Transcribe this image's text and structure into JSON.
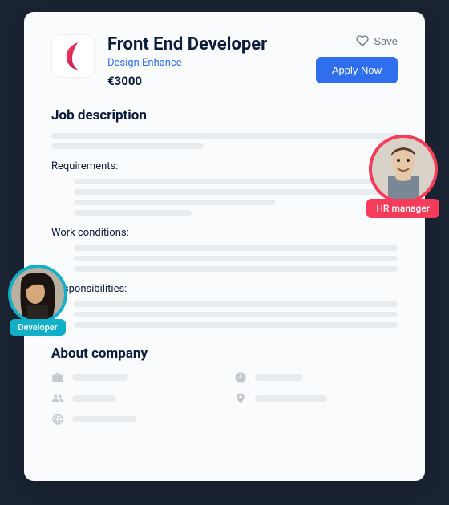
{
  "header": {
    "job_title": "Front End Developer",
    "company": "Design Enhance",
    "salary": "€3000",
    "save_label": "Save",
    "apply_label": "Apply Now"
  },
  "sections": {
    "description_title": "Job description",
    "requirements_label": "Requirements:",
    "work_conditions_label": "Work conditions:",
    "responsibilities_label": "Responsibilities:",
    "about_title": "About company"
  },
  "avatars": {
    "hr_label": "HR manager",
    "dev_label": "Developer"
  },
  "colors": {
    "accent_blue": "#2f6fed",
    "hr_ring": "#f73b5a",
    "dev_ring": "#11b0c8"
  }
}
